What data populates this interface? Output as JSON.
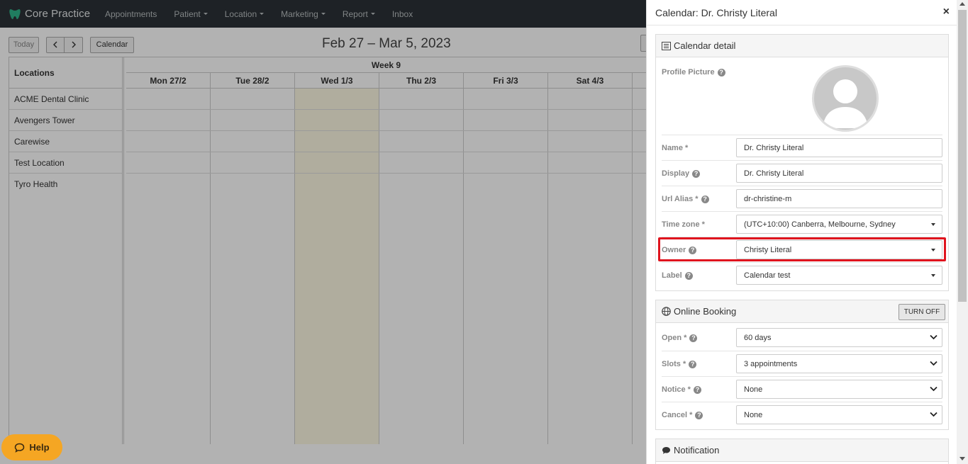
{
  "nav": {
    "brand": "Core Practice",
    "items": [
      {
        "label": "Appointments",
        "dropdown": false
      },
      {
        "label": "Patient",
        "dropdown": true
      },
      {
        "label": "Location",
        "dropdown": true
      },
      {
        "label": "Marketing",
        "dropdown": true
      },
      {
        "label": "Report",
        "dropdown": true
      },
      {
        "label": "Inbox",
        "dropdown": false
      }
    ]
  },
  "toolbar": {
    "today_label": "Today",
    "prev_icon": "chevron-left-icon",
    "next_icon": "chevron-right-icon",
    "calendar_label": "Calendar",
    "date_range": "Feb 27 – Mar 5, 2023"
  },
  "calendar": {
    "locations_header": "Locations",
    "week_label": "Week 9",
    "days": [
      "Mon 27/2",
      "Tue 28/2",
      "Wed 1/3",
      "Thu 2/3",
      "Fri 3/3",
      "Sat 4/3"
    ],
    "today_index": 2,
    "locations": [
      "ACME Dental Clinic",
      "Avengers Tower",
      "Carewise",
      "Test Location",
      "Tyro Health"
    ]
  },
  "help": {
    "label": "Help",
    "icon": "chat-bubble-icon"
  },
  "panel": {
    "title": "Calendar: Dr. Christy Literal",
    "close_label": "×",
    "detail": {
      "heading": "Calendar detail",
      "icon": "list-icon",
      "profile_picture_label": "Profile Picture",
      "fields": {
        "name": {
          "label": "Name *",
          "value": "Dr. Christy Literal"
        },
        "display": {
          "label": "Display",
          "value": "Dr. Christy Literal"
        },
        "url_alias": {
          "label": "Url Alias *",
          "value": "dr-christine-m"
        },
        "timezone": {
          "label": "Time zone *",
          "value": "(UTC+10:00) Canberra, Melbourne, Sydney"
        },
        "owner": {
          "label": "Owner",
          "value": "Christy Literal"
        },
        "label": {
          "label": "Label",
          "value": "Calendar test"
        }
      }
    },
    "online_booking": {
      "heading": "Online Booking",
      "icon": "globe-icon",
      "turn_off_label": "TURN OFF",
      "fields": {
        "open": {
          "label": "Open *",
          "value": "60 days"
        },
        "slots": {
          "label": "Slots *",
          "value": "3 appointments"
        },
        "notice": {
          "label": "Notice *",
          "value": "None"
        },
        "cancel": {
          "label": "Cancel *",
          "value": "None"
        }
      }
    },
    "notification": {
      "heading": "Notification",
      "icon": "comment-icon"
    }
  },
  "colors": {
    "nav_bg": "#2b3237",
    "highlight": "#e0141e",
    "today_col": "#fcf8e3",
    "help_btn": "#f5a623"
  }
}
